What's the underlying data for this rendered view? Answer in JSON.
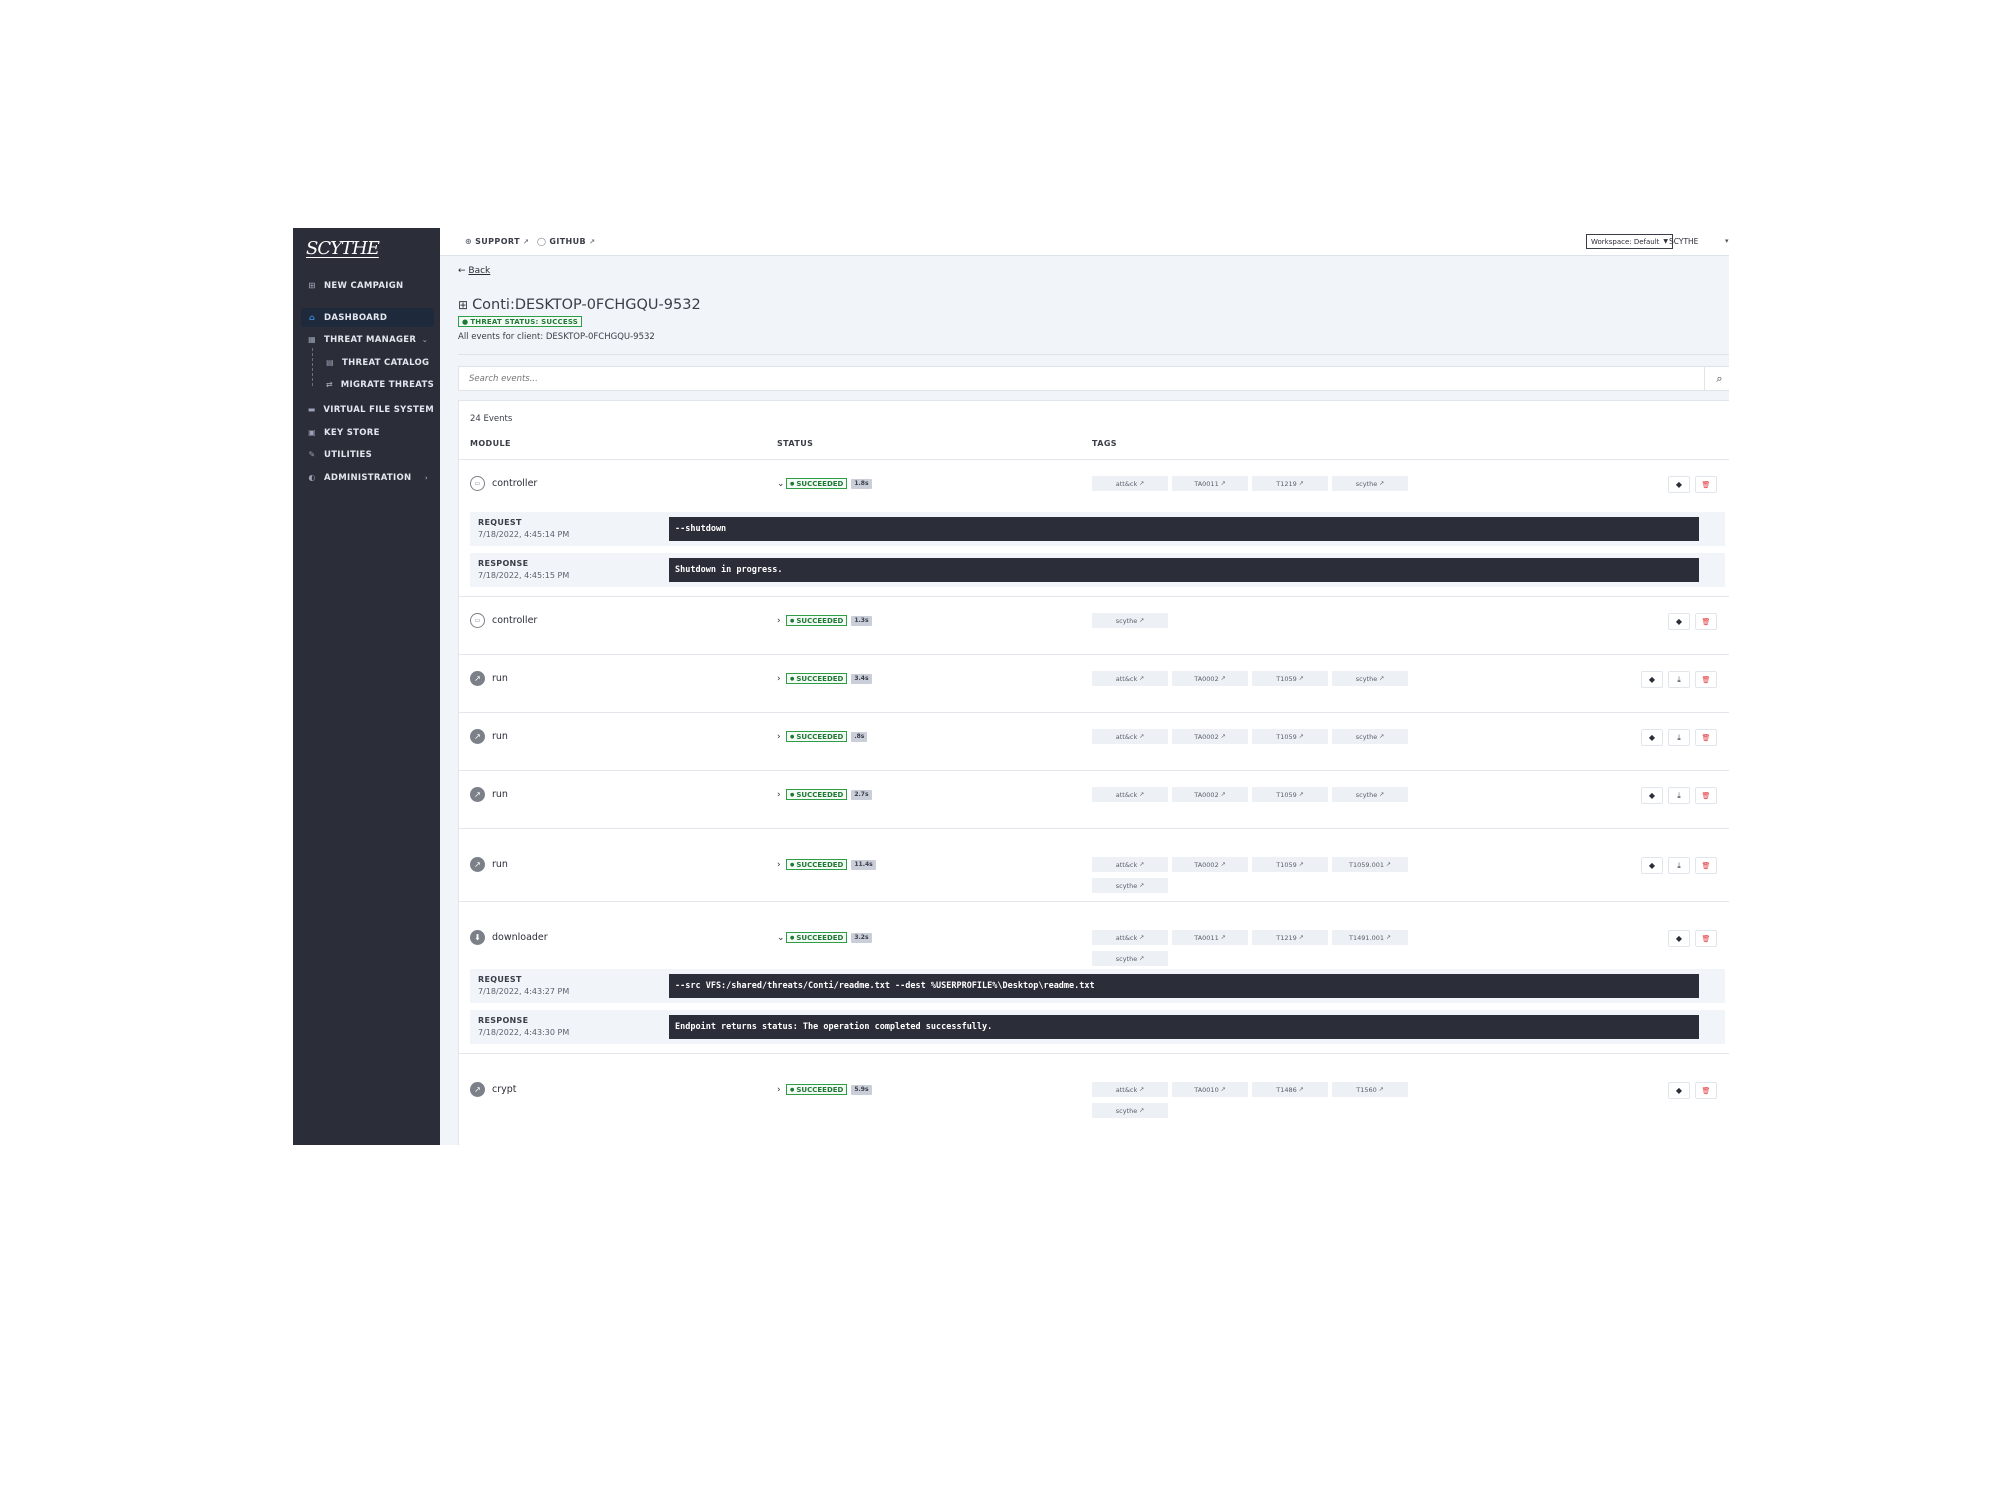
{
  "sidebar": {
    "logo": "SCYTHE",
    "items": [
      {
        "label": "NEW CAMPAIGN",
        "icon": "plus-square-icon"
      },
      {
        "label": "DASHBOARD",
        "icon": "home-icon",
        "active": true
      },
      {
        "label": "THREAT MANAGER",
        "icon": "grid-icon"
      },
      {
        "label": "THREAT CATALOG",
        "icon": "list-icon"
      },
      {
        "label": "MIGRATE THREATS",
        "icon": "swap-icon"
      },
      {
        "label": "VIRTUAL FILE SYSTEM",
        "icon": "folder-icon"
      },
      {
        "label": "KEY STORE",
        "icon": "key-icon"
      },
      {
        "label": "UTILITIES",
        "icon": "wrench-icon"
      },
      {
        "label": "ADMINISTRATION",
        "icon": "shield-icon"
      }
    ]
  },
  "topbar": {
    "support": "SUPPORT",
    "github": "GITHUB",
    "workspace": "Workspace: Default",
    "user": "SCYTHE"
  },
  "page": {
    "back": "Back",
    "title": "Conti:DESKTOP-0FCHGQU-9532",
    "status": "THREAT STATUS: SUCCESS",
    "subtitle": "All events for client: DESKTOP-0FCHGQU-9532",
    "search_placeholder": "Search events..."
  },
  "events": {
    "count": "24 Events",
    "columns": {
      "module": "MODULE",
      "status": "STATUS",
      "tags": "TAGS"
    },
    "status_label": "SUCCEEDED",
    "rows": [
      {
        "module": "controller",
        "duration": "1.8s",
        "tags": [
          "att&ck",
          "TA0011",
          "T1219",
          "scythe"
        ],
        "expanded": true,
        "request": {
          "label": "REQUEST",
          "time": "7/18/2022, 4:45:14 PM",
          "code": "--shutdown"
        },
        "response": {
          "label": "RESPONSE",
          "time": "7/18/2022, 4:45:15 PM",
          "code": "Shutdown in progress."
        }
      },
      {
        "module": "controller",
        "duration": "1.3s",
        "tags": [
          "scythe"
        ]
      },
      {
        "module": "run",
        "duration": "3.4s",
        "tags": [
          "att&ck",
          "TA0002",
          "T1059",
          "scythe"
        ]
      },
      {
        "module": "run",
        "duration": ".8s",
        "tags": [
          "att&ck",
          "TA0002",
          "T1059",
          "scythe"
        ]
      },
      {
        "module": "run",
        "duration": "2.7s",
        "tags": [
          "att&ck",
          "TA0002",
          "T1059",
          "scythe"
        ]
      },
      {
        "module": "run",
        "duration": "11.4s",
        "tags": [
          "att&ck",
          "TA0002",
          "T1059",
          "T1059.001",
          "scythe"
        ]
      },
      {
        "module": "downloader",
        "duration": "3.2s",
        "tags": [
          "att&ck",
          "TA0011",
          "T1219",
          "T1491.001",
          "scythe"
        ],
        "expanded": true,
        "request": {
          "label": "REQUEST",
          "time": "7/18/2022, 4:43:27 PM",
          "code": "--src VFS:/shared/threats/Conti/readme.txt --dest %USERPROFILE%\\Desktop\\readme.txt"
        },
        "response": {
          "label": "RESPONSE",
          "time": "7/18/2022, 4:43:30 PM",
          "code": "Endpoint returns status: The operation completed successfully."
        }
      },
      {
        "module": "crypt",
        "duration": "5.9s",
        "tags": [
          "att&ck",
          "TA0010",
          "T1486",
          "T1560",
          "scythe"
        ]
      }
    ]
  }
}
